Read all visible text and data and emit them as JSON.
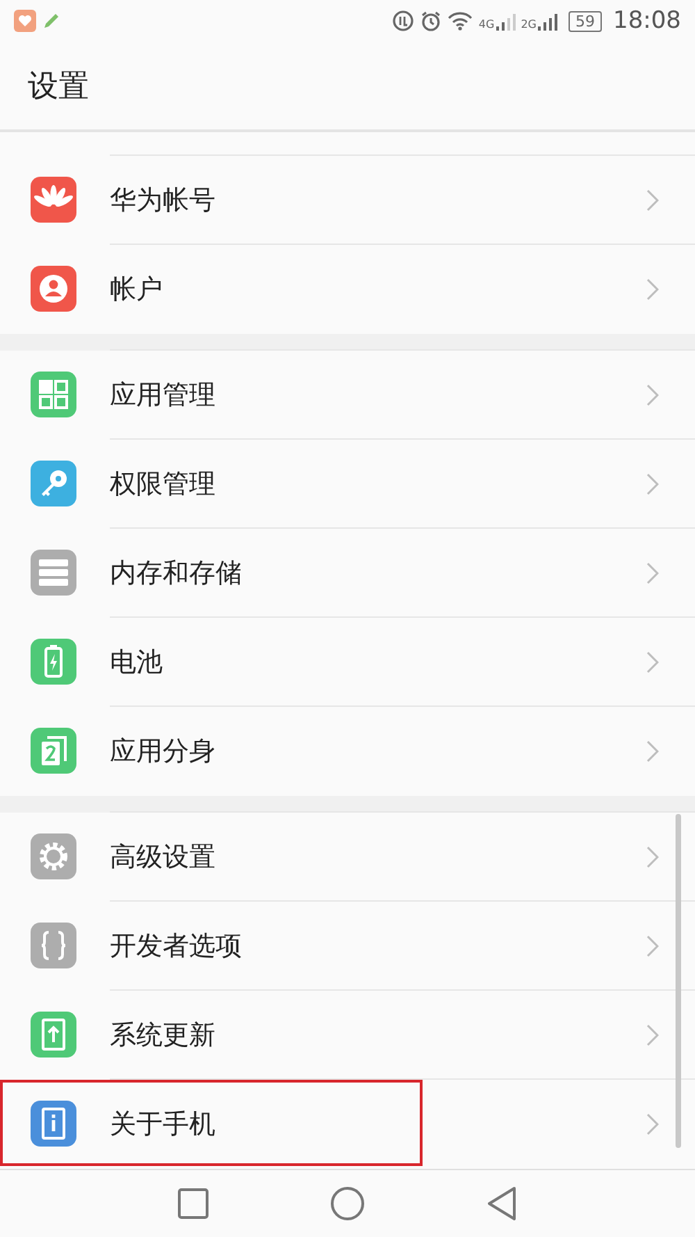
{
  "status_bar": {
    "network_1": "4G",
    "network_2": "2G",
    "battery": "59",
    "time": "18:08"
  },
  "header": {
    "title": "设置"
  },
  "sections": [
    {
      "items": [
        {
          "label": "华为帐号",
          "highlighted": false
        },
        {
          "label": "帐户",
          "highlighted": false
        }
      ]
    },
    {
      "items": [
        {
          "label": "应用管理",
          "highlighted": false
        },
        {
          "label": "权限管理",
          "highlighted": false
        },
        {
          "label": "内存和存储",
          "highlighted": false
        },
        {
          "label": "电池",
          "highlighted": false
        },
        {
          "label": "应用分身",
          "highlighted": false
        }
      ]
    },
    {
      "items": [
        {
          "label": "高级设置",
          "highlighted": false
        },
        {
          "label": "开发者选项",
          "highlighted": false
        },
        {
          "label": "系统更新",
          "highlighted": false
        },
        {
          "label": "关于手机",
          "highlighted": true
        }
      ]
    }
  ]
}
